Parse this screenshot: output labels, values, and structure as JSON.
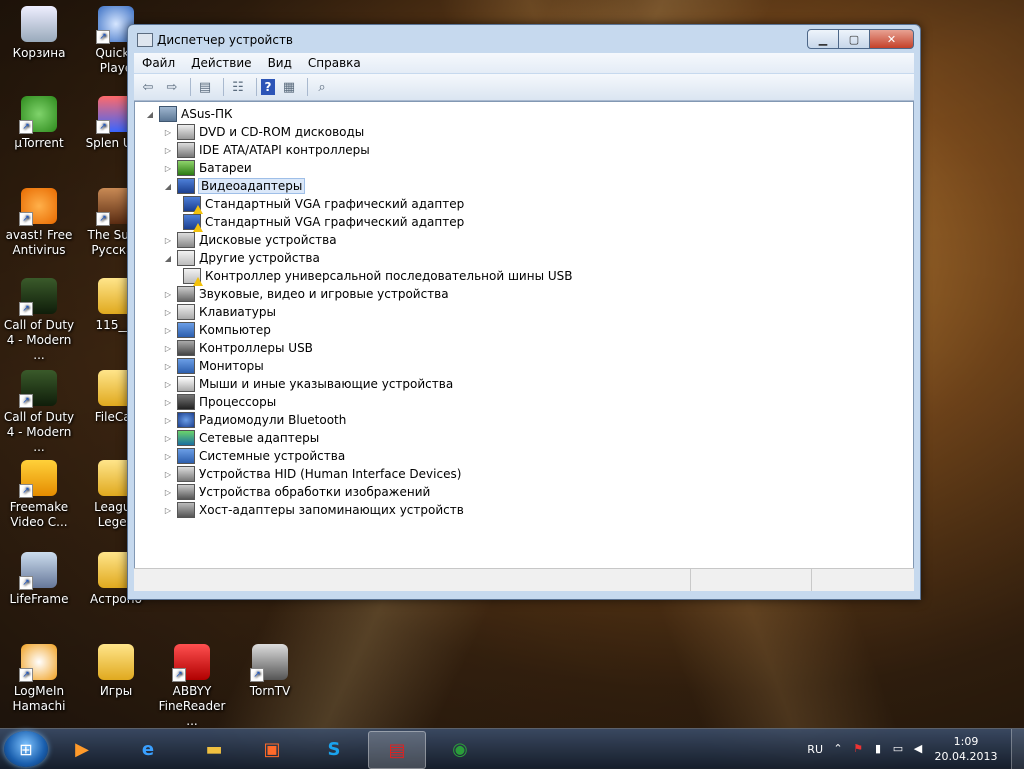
{
  "desktop": {
    "icons": [
      {
        "label": "Корзина",
        "icon": "recycle-bin-icon"
      },
      {
        "label": "µTorrent",
        "icon": "utorrent-icon"
      },
      {
        "label": "avast! Free Antivirus",
        "icon": "avast-icon"
      },
      {
        "label": "Call of Duty 4 - Modern ...",
        "icon": "cod4-icon"
      },
      {
        "label": "Call of Duty 4 - Modern ...",
        "icon": "cod4-icon"
      },
      {
        "label": "Freemake Video C...",
        "icon": "freemake-icon"
      },
      {
        "label": "LifeFrame",
        "icon": "lifeframe-icon"
      },
      {
        "label": "LogMeIn Hamachi",
        "icon": "hamachi-icon"
      },
      {
        "label": "QuickT Playe",
        "icon": "quicktime-icon"
      },
      {
        "label": "Splen Utili",
        "icon": "splendid-icon"
      },
      {
        "label": "The Suffe Русская",
        "icon": "suffering-icon"
      },
      {
        "label": "115___",
        "icon": "folder-icon"
      },
      {
        "label": "FileCac",
        "icon": "folder-icon"
      },
      {
        "label": "League Legen",
        "icon": "folder-icon"
      },
      {
        "label": "Астроно",
        "icon": "folder-icon"
      },
      {
        "label": "Игры",
        "icon": "folder-icon"
      },
      {
        "label": "ABBYY FineReader ...",
        "icon": "abbyy-icon"
      },
      {
        "label": "TornTV",
        "icon": "torntv-icon"
      }
    ]
  },
  "window": {
    "title": "Диспетчер устройств",
    "controls": {
      "minimize": "▁",
      "maximize": "▢",
      "close": "✕"
    },
    "menu": [
      "Файл",
      "Действие",
      "Вид",
      "Справка"
    ],
    "toolbar": [
      "back-arrow-icon",
      "forward-arrow-icon",
      "show-hide-tree-icon",
      "properties-icon",
      "help-icon",
      "update-driver-icon",
      "scan-hardware-icon"
    ],
    "tree": {
      "root": "ASus-ПК",
      "items": [
        {
          "label": "DVD и CD-ROM дисководы",
          "icon": "dvd-drive-icon",
          "expanded": false,
          "children": []
        },
        {
          "label": "IDE ATA/ATAPI контроллеры",
          "icon": "ide-controller-icon",
          "expanded": false,
          "children": []
        },
        {
          "label": "Батареи",
          "icon": "battery-icon",
          "expanded": false,
          "children": []
        },
        {
          "label": "Видеоадаптеры",
          "icon": "display-adapter-icon",
          "expanded": true,
          "selected": true,
          "children": [
            {
              "label": "Стандартный VGA графический адаптер",
              "icon": "display-adapter-icon",
              "warning": true
            },
            {
              "label": "Стандартный VGA графический адаптер",
              "icon": "display-adapter-icon",
              "warning": true
            }
          ]
        },
        {
          "label": "Дисковые устройства",
          "icon": "disk-drive-icon",
          "expanded": false,
          "children": []
        },
        {
          "label": "Другие устройства",
          "icon": "unknown-device-icon",
          "expanded": true,
          "children": [
            {
              "label": "Контроллер универсальной последовательной шины USB",
              "icon": "unknown-device-icon",
              "warning": true
            }
          ]
        },
        {
          "label": "Звуковые, видео и игровые устройства",
          "icon": "speaker-icon",
          "expanded": false,
          "children": []
        },
        {
          "label": "Клавиатуры",
          "icon": "keyboard-icon",
          "expanded": false,
          "children": []
        },
        {
          "label": "Компьютер",
          "icon": "computer-icon",
          "expanded": false,
          "children": []
        },
        {
          "label": "Контроллеры USB",
          "icon": "usb-icon",
          "expanded": false,
          "children": []
        },
        {
          "label": "Мониторы",
          "icon": "monitor-icon",
          "expanded": false,
          "children": []
        },
        {
          "label": "Мыши и иные указывающие устройства",
          "icon": "mouse-icon",
          "expanded": false,
          "children": []
        },
        {
          "label": "Процессоры",
          "icon": "processor-icon",
          "expanded": false,
          "children": []
        },
        {
          "label": "Радиомодули Bluetooth",
          "icon": "bluetooth-icon",
          "expanded": false,
          "children": []
        },
        {
          "label": "Сетевые адаптеры",
          "icon": "network-adapter-icon",
          "expanded": false,
          "children": []
        },
        {
          "label": "Системные устройства",
          "icon": "system-device-icon",
          "expanded": false,
          "children": []
        },
        {
          "label": "Устройства HID (Human Interface Devices)",
          "icon": "hid-icon",
          "expanded": false,
          "children": []
        },
        {
          "label": "Устройства обработки изображений",
          "icon": "camera-icon",
          "expanded": false,
          "children": []
        },
        {
          "label": "Хост-адаптеры запоминающих устройств",
          "icon": "storage-controller-icon",
          "expanded": false,
          "children": []
        }
      ]
    }
  },
  "taskbar": {
    "apps": [
      "media-player-icon",
      "internet-explorer-icon",
      "explorer-icon",
      "control-panel-icon",
      "skype-icon",
      "device-manager-icon",
      "chrome-icon"
    ],
    "tray": {
      "language": "RU",
      "time": "1:09",
      "date": "20.04.2013"
    }
  }
}
